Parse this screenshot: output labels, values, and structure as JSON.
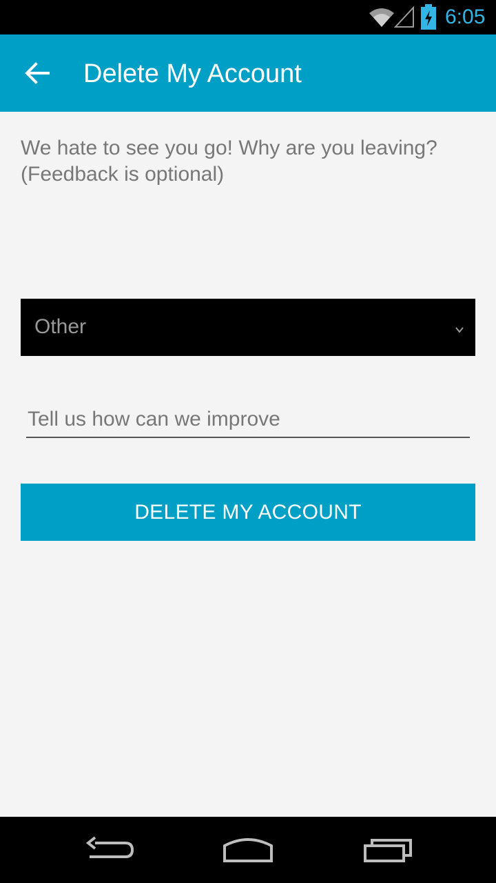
{
  "status_bar": {
    "time": "6:05",
    "icons": [
      "wifi-icon",
      "signal-icon",
      "battery-charging-icon"
    ],
    "clock_color": "#33b5e5"
  },
  "app_bar": {
    "title": "Delete My Account",
    "back_icon": "arrow-left-icon",
    "color": "#00a0c6"
  },
  "form": {
    "intro_line1": "We hate to see you go! Why are you leaving?",
    "intro_line2": "(Feedback is optional)",
    "reason_selected": "Other",
    "feedback_placeholder": "Tell us how can we improve",
    "delete_label": "DELETE MY ACCOUNT"
  },
  "nav_bar": {
    "icons": [
      "back-icon",
      "home-icon",
      "recent-apps-icon"
    ]
  }
}
